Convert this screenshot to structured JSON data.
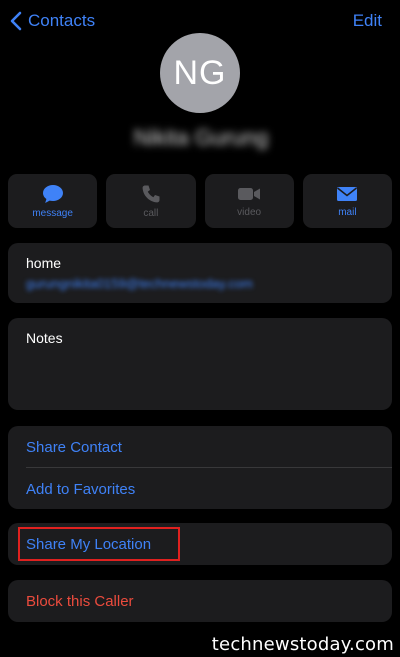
{
  "nav": {
    "back_label": "Contacts",
    "edit_label": "Edit"
  },
  "contact": {
    "initials": "NG",
    "name": "Nikita Gurung"
  },
  "actions": [
    {
      "label": "message",
      "icon": "message-bubble-icon",
      "enabled": true
    },
    {
      "label": "call",
      "icon": "phone-icon",
      "enabled": false
    },
    {
      "label": "video",
      "icon": "video-camera-icon",
      "enabled": false
    },
    {
      "label": "mail",
      "icon": "envelope-icon",
      "enabled": true
    }
  ],
  "email": {
    "label": "home",
    "value": "gurungnikita0159@technewstoday.com"
  },
  "notes": {
    "label": "Notes"
  },
  "options": {
    "share_contact": "Share Contact",
    "add_to_favorites": "Add to Favorites",
    "share_my_location": "Share My Location",
    "block_caller": "Block this Caller"
  },
  "watermark": "technewstoday.com",
  "colors": {
    "background": "#000000",
    "card": "#1c1c1e",
    "accent": "#3f82f7",
    "destructive": "#eb4b3d",
    "highlight_box": "#e0211f"
  }
}
